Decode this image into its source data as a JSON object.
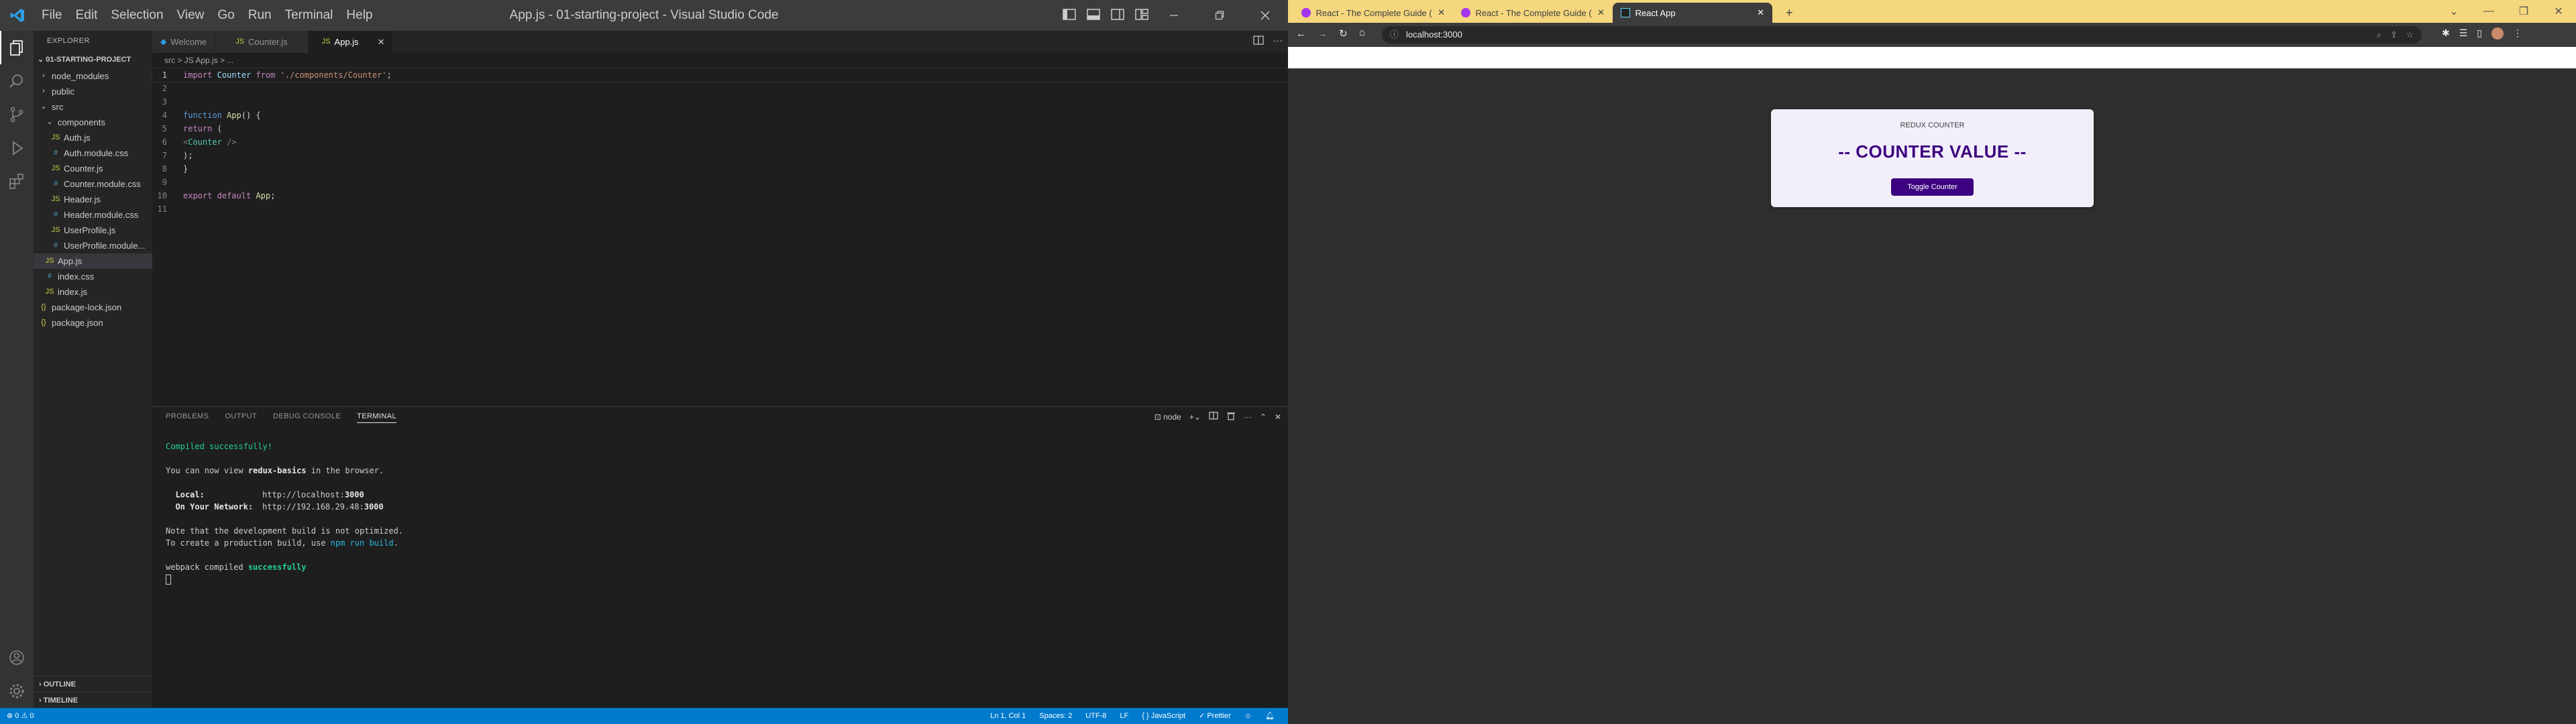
{
  "vscode": {
    "menu": [
      "File",
      "Edit",
      "Selection",
      "View",
      "Go",
      "Run",
      "Terminal",
      "Help"
    ],
    "window_title": "App.js - 01-starting-project - Visual Studio Code",
    "explorer_label": "EXPLORER",
    "project_label": "01-STARTING-PROJECT",
    "tree": [
      {
        "label": "node_modules",
        "icon": "›",
        "indent": 1
      },
      {
        "label": "public",
        "icon": "›",
        "indent": 1
      },
      {
        "label": "src",
        "icon": "⌄",
        "indent": 1
      },
      {
        "label": "components",
        "icon": "⌄",
        "indent": 2
      },
      {
        "label": "Auth.js",
        "icon": "JS",
        "indent": 3
      },
      {
        "label": "Auth.module.css",
        "icon": "#",
        "indent": 3
      },
      {
        "label": "Counter.js",
        "icon": "JS",
        "indent": 3
      },
      {
        "label": "Counter.module.css",
        "icon": "#",
        "indent": 3
      },
      {
        "label": "Header.js",
        "icon": "JS",
        "indent": 3
      },
      {
        "label": "Header.module.css",
        "icon": "#",
        "indent": 3
      },
      {
        "label": "UserProfile.js",
        "icon": "JS",
        "indent": 3
      },
      {
        "label": "UserProfile.module...",
        "icon": "#",
        "indent": 3
      },
      {
        "label": "App.js",
        "icon": "JS",
        "indent": 2,
        "active": true
      },
      {
        "label": "index.css",
        "icon": "#",
        "indent": 2
      },
      {
        "label": "index.js",
        "icon": "JS",
        "indent": 2
      },
      {
        "label": "package-lock.json",
        "icon": "{}",
        "indent": 1
      },
      {
        "label": "package.json",
        "icon": "{}",
        "indent": 1
      }
    ],
    "outline_label": "OUTLINE",
    "timeline_label": "TIMELINE",
    "tabs": [
      {
        "label": "Welcome",
        "active": false
      },
      {
        "label": "Counter.js",
        "active": false
      },
      {
        "label": "App.js",
        "active": true
      }
    ],
    "breadcrumb": "src > JS App.js > ...",
    "code_lines": [
      "import Counter from './components/Counter';",
      "",
      "",
      "function App() {",
      "  return (",
      "    <Counter />",
      "  );",
      "}",
      "",
      "export default App;",
      ""
    ],
    "panel_tabs": [
      "PROBLEMS",
      "OUTPUT",
      "DEBUG CONSOLE",
      "TERMINAL"
    ],
    "terminal_shell": "node",
    "terminal": {
      "compiled": "Compiled successfully!",
      "view_prefix": "You can now view ",
      "app_name": "redux-basics",
      "view_suffix": " in the browser.",
      "local_label": "  Local:",
      "local_url": "http://localhost:",
      "local_port": "3000",
      "network_label": "  On Your Network:",
      "network_url": "http://192.168.29.48:",
      "network_port": "3000",
      "note1": "Note that the development build is not optimized.",
      "note2_prefix": "To create a production build, use ",
      "note2_cmd": "npm run build",
      "note2_suffix": ".",
      "webpack_prefix": "webpack compiled ",
      "webpack_status": "successfully"
    },
    "status": {
      "left": "⊗ 0 ⚠ 0",
      "position": "Ln 1, Col 1",
      "spaces": "Spaces: 2",
      "encoding": "UTF-8",
      "eol": "LF",
      "language": "{ } JavaScript",
      "formatter": "✓ Prettier"
    },
    "accent_color": "#007acc"
  },
  "chrome": {
    "tabs": [
      {
        "label": "React - The Complete Guide (incl...",
        "active": false
      },
      {
        "label": "React - The Complete Guide (incl...",
        "active": false
      },
      {
        "label": "React App",
        "active": true
      }
    ],
    "new_tab": "+",
    "url": "localhost:3000",
    "page": {
      "card_title": "REDUX COUNTER",
      "counter_value": "-- COUNTER VALUE --",
      "toggle_button": "Toggle Counter",
      "brand_color": "#3c0080"
    }
  }
}
